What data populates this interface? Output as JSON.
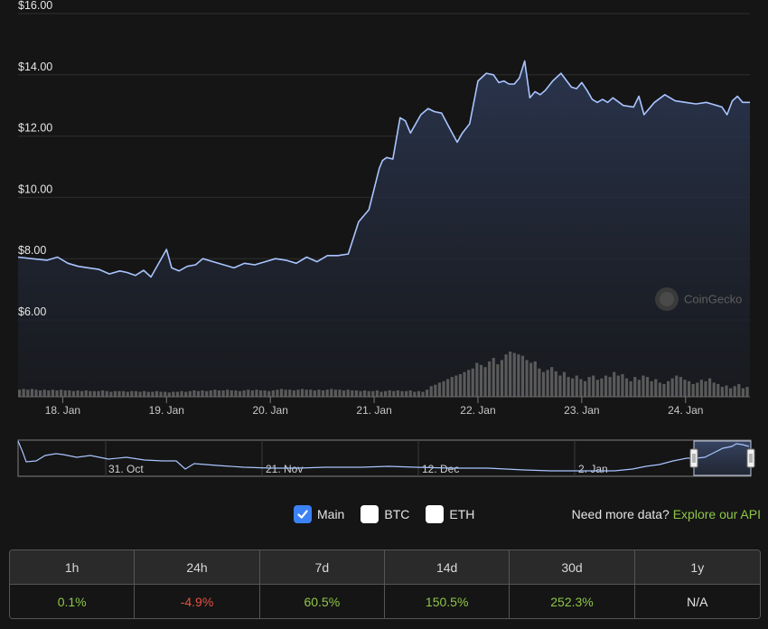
{
  "chart_data": {
    "type": "line",
    "y_axis": {
      "labels": [
        "$16.00",
        "$14.00",
        "$12.00",
        "$10.00",
        "$8.00",
        "$6.00"
      ],
      "values": [
        16,
        14,
        12,
        10,
        8,
        6
      ],
      "ylim": [
        6,
        16
      ],
      "grid": true
    },
    "x_axis": {
      "labels": [
        "18. Jan",
        "19. Jan",
        "20. Jan",
        "21. Jan",
        "22. Jan",
        "23. Jan",
        "24. Jan"
      ],
      "xlim": [
        17.57,
        24.62
      ]
    },
    "price": {
      "x": [
        17.57,
        17.7,
        17.85,
        17.95,
        18.05,
        18.15,
        18.25,
        18.35,
        18.45,
        18.55,
        18.62,
        18.7,
        18.78,
        18.85,
        18.9,
        19.0,
        19.05,
        19.12,
        19.2,
        19.28,
        19.35,
        19.45,
        19.55,
        19.65,
        19.75,
        19.85,
        19.95,
        20.05,
        20.15,
        20.25,
        20.35,
        20.45,
        20.55,
        20.65,
        20.75,
        20.85,
        20.95,
        21.05,
        21.08,
        21.12,
        21.18,
        21.25,
        21.3,
        21.35,
        21.45,
        21.52,
        21.58,
        21.65,
        21.72,
        21.8,
        21.85,
        21.92,
        22.0,
        22.08,
        22.15,
        22.2,
        22.25,
        22.3,
        22.35,
        22.4,
        22.45,
        22.5,
        22.55,
        22.6,
        22.65,
        22.72,
        22.8,
        22.9,
        22.95,
        23.0,
        23.05,
        23.1,
        23.15,
        23.2,
        23.25,
        23.3,
        23.4,
        23.5,
        23.55,
        23.6,
        23.7,
        23.8,
        23.9,
        24.0,
        24.1,
        24.2,
        24.25,
        24.3,
        24.35,
        24.4,
        24.45,
        24.5,
        24.55,
        24.62
      ],
      "y": [
        8.05,
        8.0,
        7.95,
        8.05,
        7.85,
        7.75,
        7.7,
        7.65,
        7.5,
        7.6,
        7.55,
        7.45,
        7.62,
        7.4,
        7.7,
        8.3,
        7.7,
        7.6,
        7.75,
        7.8,
        8.0,
        7.9,
        7.8,
        7.7,
        7.85,
        7.8,
        7.9,
        8.0,
        7.95,
        7.85,
        8.05,
        7.9,
        8.1,
        8.1,
        8.15,
        9.2,
        9.6,
        10.95,
        11.2,
        11.3,
        11.25,
        12.6,
        12.5,
        12.1,
        12.7,
        12.9,
        12.8,
        12.75,
        12.3,
        11.8,
        12.1,
        12.4,
        13.8,
        14.05,
        14.0,
        13.75,
        13.8,
        13.7,
        13.7,
        13.9,
        14.45,
        13.25,
        13.45,
        13.35,
        13.5,
        13.8,
        14.05,
        13.6,
        13.55,
        13.75,
        13.5,
        13.2,
        13.1,
        13.2,
        13.1,
        13.25,
        13.0,
        12.95,
        13.3,
        12.7,
        13.1,
        13.35,
        13.15,
        13.1,
        13.05,
        13.1,
        13.05,
        13.0,
        12.95,
        12.7,
        13.15,
        13.3,
        13.1,
        13.1
      ]
    },
    "volume": {
      "note": "relative volume bars (unitless)",
      "values": [
        10,
        11,
        10,
        11,
        10,
        9,
        10,
        9,
        10,
        9,
        10,
        9,
        9,
        8,
        9,
        8,
        9,
        8,
        8,
        8,
        9,
        8,
        7,
        8,
        8,
        8,
        7,
        8,
        8,
        7,
        8,
        7,
        7,
        8,
        7,
        7,
        6,
        7,
        7,
        8,
        7,
        8,
        9,
        8,
        9,
        8,
        9,
        10,
        9,
        9,
        10,
        9,
        9,
        8,
        9,
        10,
        9,
        10,
        9,
        9,
        8,
        9,
        10,
        11,
        10,
        10,
        9,
        10,
        11,
        10,
        10,
        9,
        10,
        9,
        10,
        11,
        10,
        10,
        9,
        10,
        9,
        9,
        8,
        9,
        8,
        8,
        9,
        7,
        8,
        9,
        8,
        9,
        8,
        8,
        9,
        7,
        8,
        7,
        10,
        15,
        17,
        20,
        22,
        25,
        28,
        30,
        32,
        35,
        38,
        40,
        48,
        45,
        42,
        50,
        55,
        46,
        52,
        60,
        64,
        62,
        60,
        58,
        52,
        48,
        50,
        40,
        35,
        38,
        42,
        36,
        30,
        35,
        28,
        26,
        30,
        25,
        22,
        28,
        30,
        24,
        26,
        30,
        28,
        35,
        30,
        32,
        26,
        22,
        28,
        24,
        30,
        28,
        22,
        25,
        20,
        18,
        22,
        26,
        30,
        28,
        24,
        22,
        18,
        20,
        24,
        22,
        26,
        20,
        18,
        14,
        16,
        12,
        15,
        18,
        12,
        14
      ]
    },
    "navigator": {
      "labels": [
        "31. Oct",
        "21. Nov",
        "12. Dec",
        "2. Jan"
      ]
    },
    "legend": {
      "placement": "bottom-center"
    },
    "colors": {
      "line": "#a9c4ff",
      "area_top": "#2b3650",
      "volume": "#5a5a5a"
    }
  },
  "watermark": {
    "text": "CoinGecko"
  },
  "legend_items": [
    {
      "label": "Main",
      "checked": true
    },
    {
      "label": "BTC",
      "checked": false
    },
    {
      "label": "ETH",
      "checked": false
    }
  ],
  "api": {
    "prompt": "Need more data?",
    "link": "Explore our API",
    "link_color": "#8dc647"
  },
  "performance": {
    "headers": [
      "1h",
      "24h",
      "7d",
      "14d",
      "30d",
      "1y"
    ],
    "values": [
      "0.1%",
      "-4.9%",
      "60.5%",
      "150.5%",
      "252.3%",
      "N/A"
    ],
    "value_colors": [
      "#8dc647",
      "#e15241",
      "#8dc647",
      "#8dc647",
      "#8dc647",
      "#e4e4e4"
    ]
  }
}
